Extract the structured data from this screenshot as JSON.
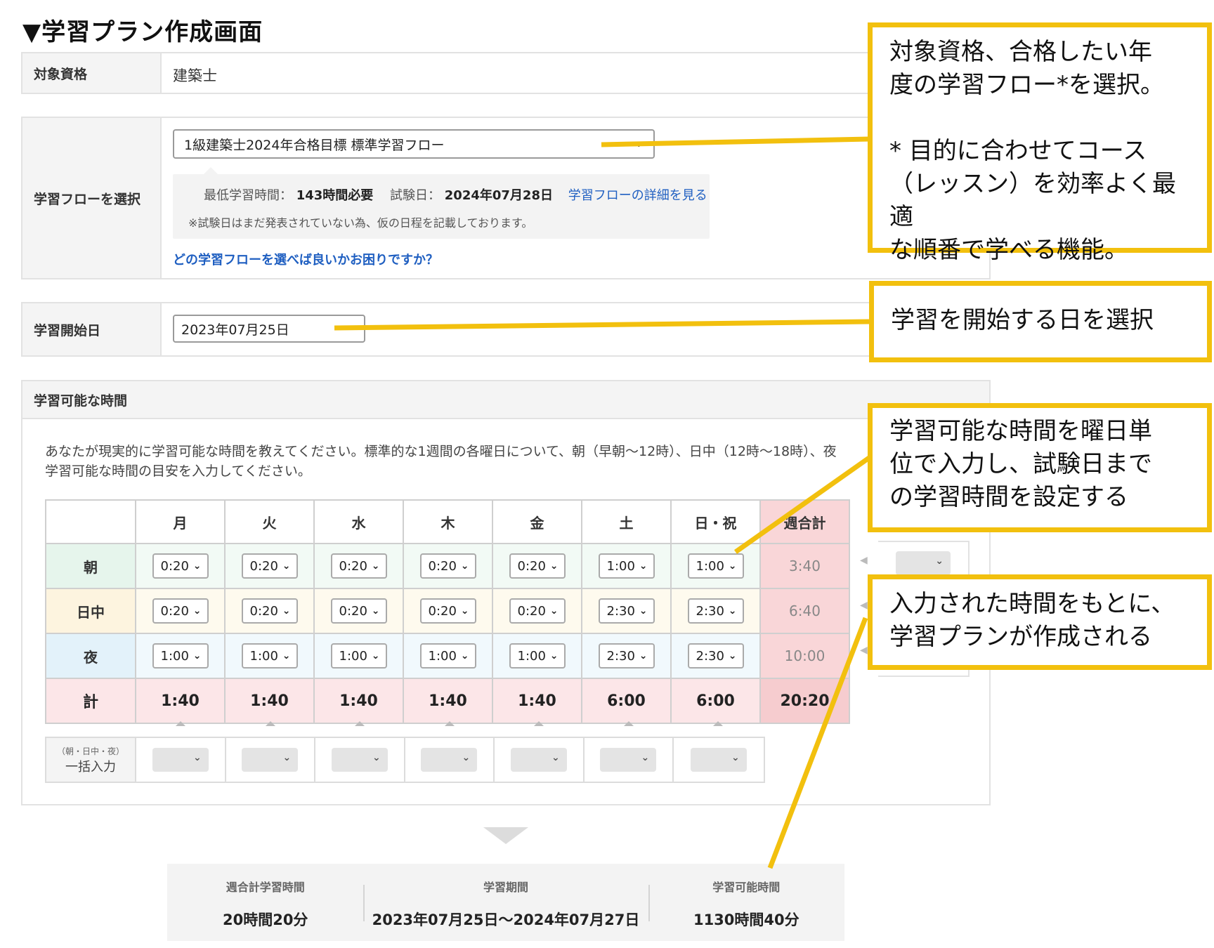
{
  "page": {
    "title": "▼学習プラン作成画面"
  },
  "colors": {
    "accent_yellow": "#f2c00e",
    "link_blue": "#1f5fc1",
    "total_pink": "#fce6e8",
    "morning_green": "#e6f5ec",
    "day_yellow": "#fdf4df",
    "night_blue": "#e3f2fa"
  },
  "shikaku": {
    "label": "対象資格",
    "value": "建築士"
  },
  "flow": {
    "label": "学習フローを選択",
    "selected": "1級建築士2024年合格目標 標準学習フロー",
    "min_time_label": "最低学習時間：",
    "min_time_value": "143時間必要",
    "exam_label": "試験日：",
    "exam_value": "2024年07月28日",
    "detail_link": "学習フローの詳細を見る",
    "note": "※試験日はまだ発表されていない為、仮の日程を記載しております。",
    "help_link": "どの学習フローを選べば良いかお困りですか？"
  },
  "start": {
    "label": "学習開始日",
    "value": "2023年07月25日"
  },
  "available": {
    "heading": "学習可能な時間",
    "description_1": "あなたが現実的に学習可能な時間を教えてください。標準的な1週間の各曜日について、朝（早朝～12時）、日中（12時～18時）、夜",
    "description_2": "学習可能な時間の目安を入力してください。",
    "days": [
      "月",
      "火",
      "水",
      "木",
      "金",
      "土",
      "日・祝"
    ],
    "week_total_header": "週合計",
    "rows": [
      {
        "label": "朝",
        "values": [
          "0:20",
          "0:20",
          "0:20",
          "0:20",
          "0:20",
          "1:00",
          "1:00"
        ],
        "total": "3:40"
      },
      {
        "label": "日中",
        "values": [
          "0:20",
          "0:20",
          "0:20",
          "0:20",
          "0:20",
          "2:30",
          "2:30"
        ],
        "total": "6:40"
      },
      {
        "label": "夜",
        "values": [
          "1:00",
          "1:00",
          "1:00",
          "1:00",
          "1:00",
          "2:30",
          "2:30"
        ],
        "total": "10:00"
      }
    ],
    "sum_row": {
      "label": "計",
      "values": [
        "1:40",
        "1:40",
        "1:40",
        "1:40",
        "1:40",
        "6:00",
        "6:00"
      ],
      "total": "20:20"
    },
    "bulk": {
      "small_label": "（朝・日中・夜）",
      "label": "一括入力"
    }
  },
  "summary": {
    "weekly_label": "週合計学習時間",
    "weekly_value": "20時間20分",
    "period_label": "学習期間",
    "period_value": "2023年07月25日～2024年07月27日",
    "available_label": "学習可能時間",
    "available_value": "1130時間40分"
  },
  "callouts": {
    "c1": "対象資格、合格したい年\n度の学習フロー*を選択。\n\n* 目的に合わせてコース\n（レッスン）を効率よく最適\nな順番で学べる機能。",
    "c2": "学習を開始する日を選択",
    "c3": "学習可能な時間を曜日単\n位で入力し、試験日まで\nの学習時間を設定する",
    "c4": "入力された時間をもとに、\n学習プランが作成される"
  },
  "icons": {
    "select_chevron": "chevron-down-icon",
    "panel_arrow": "triangle-down-icon",
    "bulk_arrow": "caret-up-icon"
  }
}
